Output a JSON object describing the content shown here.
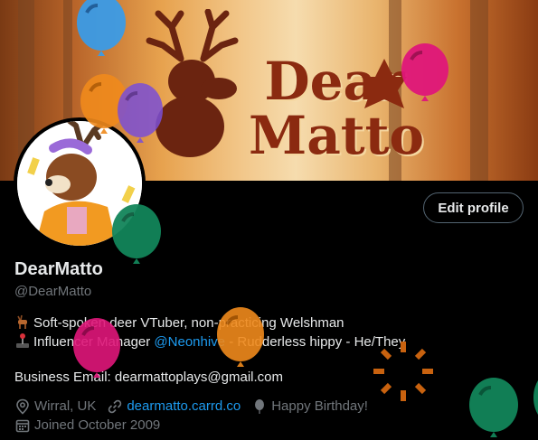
{
  "banner": {
    "title_line1": "Dear",
    "title_line2": "Matto"
  },
  "profile": {
    "edit_label": "Edit profile",
    "display_name": "DearMatto",
    "handle": "@DearMatto",
    "bio_line1_text": "Soft-spoken deer VTuber, non-practicing Welshman",
    "bio_line2_prefix": "Influencer Manager ",
    "bio_line2_mention": "@Neonhive",
    "bio_line2_suffix": " - Rudderless hippy - He/They",
    "bio_email": "Business Email: dearmattoplays@gmail.com",
    "location": "Wirral, UK",
    "website": "dearmatto.carrd.co",
    "birthday": "Happy Birthday!",
    "joined": "Joined October 2009"
  },
  "colors": {
    "accent": "#1d9bf0",
    "muted": "#71767b",
    "balloon_blue": "#3b9be6",
    "balloon_orange": "#f08a1c",
    "balloon_purple": "#7b4fd6",
    "balloon_pink": "#e0177a",
    "balloon_green": "#12855a"
  },
  "icons": {
    "bio_line1": "deer-emoji",
    "bio_line2": "joystick-emoji",
    "location": "location-pin-icon",
    "website": "link-icon",
    "birthday": "balloon-icon",
    "joined": "calendar-icon"
  }
}
